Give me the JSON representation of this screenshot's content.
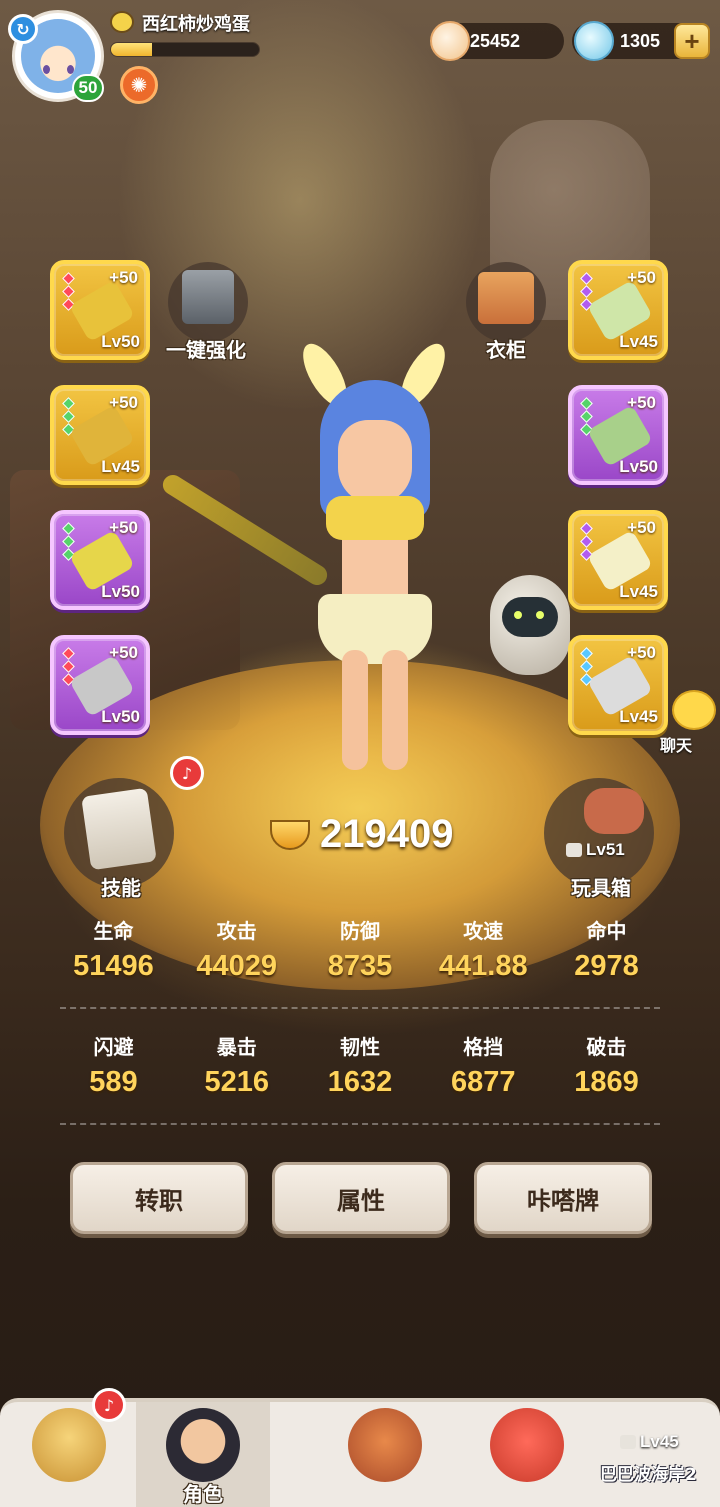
{
  "player": {
    "name": "西红柿炒鸡蛋",
    "level": "50",
    "exp_fraction": 0.28,
    "icons": [
      "refresh-icon",
      "emoji-icon",
      "buff-icon"
    ]
  },
  "currency": {
    "shells": "25452",
    "gems": "1305",
    "add_label": "+"
  },
  "actions": {
    "enhance": "一键强化",
    "wardrobe": "衣柜",
    "skills": "技能",
    "toybox": "玩具箱",
    "toybox_lock_level": "Lv51",
    "chat": "聊天"
  },
  "equipment_left": [
    {
      "plus": "+50",
      "level": "Lv50",
      "rarity": "gold",
      "gems": "red",
      "item": "#e8c23a"
    },
    {
      "plus": "+50",
      "level": "Lv45",
      "rarity": "gold",
      "gems": "green",
      "item": "#e0b43a"
    },
    {
      "plus": "+50",
      "level": "Lv50",
      "rarity": "purple",
      "gems": "green",
      "item": "#e6d64a"
    },
    {
      "plus": "+50",
      "level": "Lv50",
      "rarity": "purple",
      "gems": "red",
      "item": "#c8c8c8"
    }
  ],
  "equipment_right": [
    {
      "plus": "+50",
      "level": "Lv45",
      "rarity": "gold",
      "gems": "purple",
      "item": "#cfe6a8"
    },
    {
      "plus": "+50",
      "level": "Lv50",
      "rarity": "purple",
      "gems": "green",
      "item": "#a8d08a"
    },
    {
      "plus": "+50",
      "level": "Lv45",
      "rarity": "gold",
      "gems": "purple",
      "item": "#f4f0c8"
    },
    {
      "plus": "+50",
      "level": "Lv45",
      "rarity": "gold",
      "gems": "blue",
      "item": "#dcdcdc"
    }
  ],
  "combat_power": "219409",
  "stats": [
    [
      {
        "label": "生命",
        "value": "51496"
      },
      {
        "label": "攻击",
        "value": "44029"
      },
      {
        "label": "防御",
        "value": "8735"
      },
      {
        "label": "攻速",
        "value": "441.88"
      },
      {
        "label": "命中",
        "value": "2978"
      }
    ],
    [
      {
        "label": "闪避",
        "value": "589"
      },
      {
        "label": "暴击",
        "value": "5216"
      },
      {
        "label": "韧性",
        "value": "1632"
      },
      {
        "label": "格挡",
        "value": "6877"
      },
      {
        "label": "破击",
        "value": "1869"
      }
    ]
  ],
  "buttons": {
    "job_change": "转职",
    "attributes": "属性",
    "card": "咔嗒牌"
  },
  "nav": {
    "items": [
      {
        "label": ""
      },
      {
        "label": "角色"
      },
      {
        "label": ""
      },
      {
        "label": ""
      }
    ],
    "locked_level": "Lv45",
    "locked_label": "巴巴波海岸2"
  },
  "colors": {
    "accent_gold": "#ffd45c",
    "rarity_gold": "#f2c442",
    "rarity_purple": "#c87be8",
    "notification_red": "#e83a3a"
  }
}
